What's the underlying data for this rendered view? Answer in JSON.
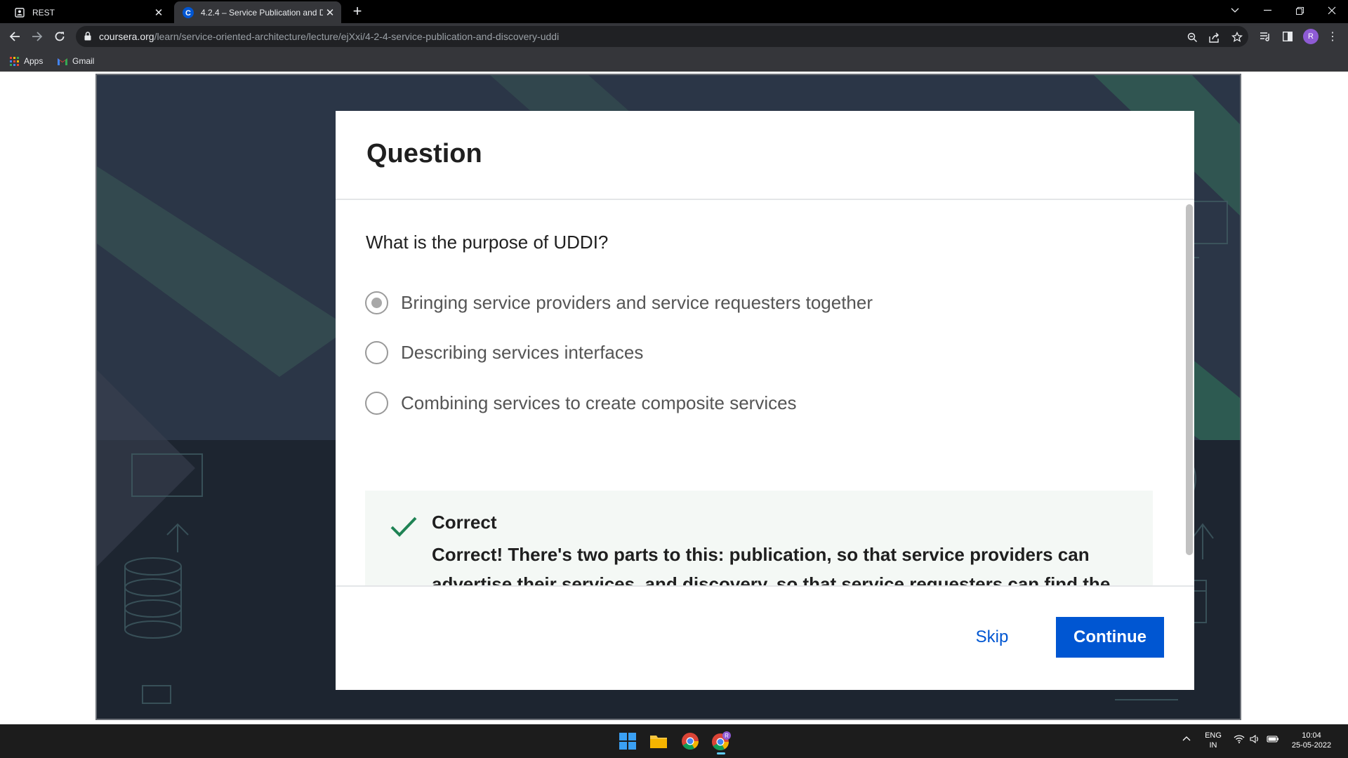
{
  "browser": {
    "tabs": [
      {
        "title": "REST",
        "active": false
      },
      {
        "title": "4.2.4 – Service Publication and D",
        "active": true
      }
    ],
    "url_host": "coursera.org",
    "url_path": "/learn/service-oriented-architecture/lecture/ejXxi/4-2-4-service-publication-and-discovery-uddi",
    "profile_initial": "R",
    "bookmarks": [
      {
        "label": "Apps",
        "icon": "apps-grid-icon"
      },
      {
        "label": "Gmail",
        "icon": "gmail-icon"
      }
    ]
  },
  "modal": {
    "title": "Question",
    "question": "What is the purpose of UDDI?",
    "options": [
      {
        "label": "Bringing service providers and service requesters together",
        "selected": true
      },
      {
        "label": "Describing services interfaces",
        "selected": false
      },
      {
        "label": "Combining services to create composite services",
        "selected": false
      }
    ],
    "feedback": {
      "status": "Correct",
      "text": "Correct! There's two parts to this: publication, so that service providers can advertise their services, and discovery, so that service requesters can find the services they need."
    },
    "skip_label": "Skip",
    "continue_label": "Continue"
  },
  "taskbar": {
    "language": "ENG",
    "region": "IN",
    "time": "10:04",
    "date": "25-05-2022"
  },
  "colors": {
    "accent": "#0056d2",
    "check": "#1f8354",
    "feedback_bg": "#f4f8f5"
  }
}
